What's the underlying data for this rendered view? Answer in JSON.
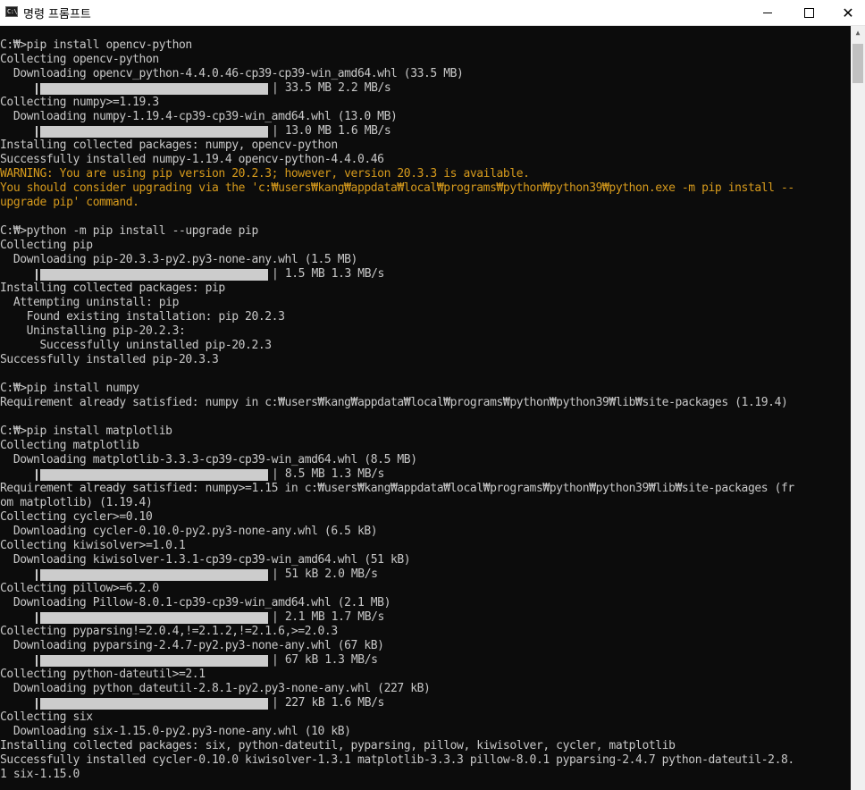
{
  "window": {
    "title": "명령 프롬프트",
    "icon_text": "C:\\",
    "minimize_glyph": "",
    "close_glyph": "✕"
  },
  "colors": {
    "background": "#0c0c0c",
    "text": "#c8c8c8",
    "warning": "#d69a1c",
    "progress_bar": "#cccccc"
  },
  "console": {
    "lines": [
      {
        "kind": "text",
        "text": "C:₩>pip install opencv-python"
      },
      {
        "kind": "text",
        "text": "Collecting opencv-python"
      },
      {
        "kind": "text",
        "text": "  Downloading opencv_python-4.4.0.46-cp39-cp39-win_amd64.whl (33.5 MB)"
      },
      {
        "kind": "progress",
        "text": "33.5 MB 2.2 MB/s",
        "progress": 1.0
      },
      {
        "kind": "text",
        "text": "Collecting numpy>=1.19.3"
      },
      {
        "kind": "text",
        "text": "  Downloading numpy-1.19.4-cp39-cp39-win_amd64.whl (13.0 MB)"
      },
      {
        "kind": "progress",
        "text": "13.0 MB 1.6 MB/s",
        "progress": 1.0
      },
      {
        "kind": "text",
        "text": "Installing collected packages: numpy, opencv-python"
      },
      {
        "kind": "text",
        "text": "Successfully installed numpy-1.19.4 opencv-python-4.4.0.46"
      },
      {
        "kind": "warn",
        "text": "WARNING: You are using pip version 20.2.3; however, version 20.3.3 is available."
      },
      {
        "kind": "warn",
        "text": "You should consider upgrading via the 'c:₩users₩kang₩appdata₩local₩programs₩python₩python39₩python.exe -m pip install --"
      },
      {
        "kind": "warn",
        "text": "upgrade pip' command."
      },
      {
        "kind": "text",
        "text": ""
      },
      {
        "kind": "text",
        "text": "C:₩>python -m pip install --upgrade pip"
      },
      {
        "kind": "text",
        "text": "Collecting pip"
      },
      {
        "kind": "text",
        "text": "  Downloading pip-20.3.3-py2.py3-none-any.whl (1.5 MB)"
      },
      {
        "kind": "progress",
        "text": "1.5 MB 1.3 MB/s",
        "progress": 1.0
      },
      {
        "kind": "text",
        "text": "Installing collected packages: pip"
      },
      {
        "kind": "text",
        "text": "  Attempting uninstall: pip"
      },
      {
        "kind": "text",
        "text": "    Found existing installation: pip 20.2.3"
      },
      {
        "kind": "text",
        "text": "    Uninstalling pip-20.2.3:"
      },
      {
        "kind": "text",
        "text": "      Successfully uninstalled pip-20.2.3"
      },
      {
        "kind": "text",
        "text": "Successfully installed pip-20.3.3"
      },
      {
        "kind": "text",
        "text": ""
      },
      {
        "kind": "text",
        "text": "C:₩>pip install numpy"
      },
      {
        "kind": "text",
        "text": "Requirement already satisfied: numpy in c:₩users₩kang₩appdata₩local₩programs₩python₩python39₩lib₩site-packages (1.19.4)"
      },
      {
        "kind": "text",
        "text": ""
      },
      {
        "kind": "text",
        "text": "C:₩>pip install matplotlib"
      },
      {
        "kind": "text",
        "text": "Collecting matplotlib"
      },
      {
        "kind": "text",
        "text": "  Downloading matplotlib-3.3.3-cp39-cp39-win_amd64.whl (8.5 MB)"
      },
      {
        "kind": "progress",
        "text": "8.5 MB 1.3 MB/s",
        "progress": 1.0
      },
      {
        "kind": "text",
        "text": "Requirement already satisfied: numpy>=1.15 in c:₩users₩kang₩appdata₩local₩programs₩python₩python39₩lib₩site-packages (fr"
      },
      {
        "kind": "text",
        "text": "om matplotlib) (1.19.4)"
      },
      {
        "kind": "text",
        "text": "Collecting cycler>=0.10"
      },
      {
        "kind": "text",
        "text": "  Downloading cycler-0.10.0-py2.py3-none-any.whl (6.5 kB)"
      },
      {
        "kind": "text",
        "text": "Collecting kiwisolver>=1.0.1"
      },
      {
        "kind": "text",
        "text": "  Downloading kiwisolver-1.3.1-cp39-cp39-win_amd64.whl (51 kB)"
      },
      {
        "kind": "progress",
        "text": "51 kB 2.0 MB/s",
        "progress": 1.0
      },
      {
        "kind": "text",
        "text": "Collecting pillow>=6.2.0"
      },
      {
        "kind": "text",
        "text": "  Downloading Pillow-8.0.1-cp39-cp39-win_amd64.whl (2.1 MB)"
      },
      {
        "kind": "progress",
        "text": "2.1 MB 1.7 MB/s",
        "progress": 1.0
      },
      {
        "kind": "text",
        "text": "Collecting pyparsing!=2.0.4,!=2.1.2,!=2.1.6,>=2.0.3"
      },
      {
        "kind": "text",
        "text": "  Downloading pyparsing-2.4.7-py2.py3-none-any.whl (67 kB)"
      },
      {
        "kind": "progress",
        "text": "67 kB 1.3 MB/s",
        "progress": 1.0
      },
      {
        "kind": "text",
        "text": "Collecting python-dateutil>=2.1"
      },
      {
        "kind": "text",
        "text": "  Downloading python_dateutil-2.8.1-py2.py3-none-any.whl (227 kB)"
      },
      {
        "kind": "progress",
        "text": "227 kB 1.6 MB/s",
        "progress": 1.0
      },
      {
        "kind": "text",
        "text": "Collecting six"
      },
      {
        "kind": "text",
        "text": "  Downloading six-1.15.0-py2.py3-none-any.whl (10 kB)"
      },
      {
        "kind": "text",
        "text": "Installing collected packages: six, python-dateutil, pyparsing, pillow, kiwisolver, cycler, matplotlib"
      },
      {
        "kind": "text",
        "text": "Successfully installed cycler-0.10.0 kiwisolver-1.3.1 matplotlib-3.3.3 pillow-8.0.1 pyparsing-2.4.7 python-dateutil-2.8."
      },
      {
        "kind": "text",
        "text": "1 six-1.15.0"
      }
    ]
  }
}
